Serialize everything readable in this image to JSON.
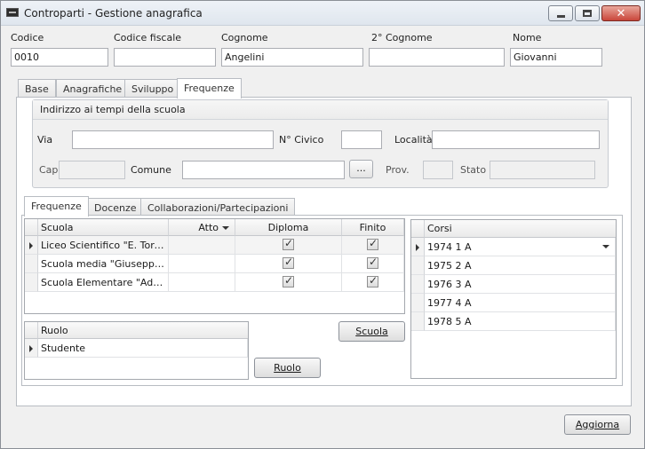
{
  "window": {
    "title": "Controparti - Gestione anagrafica"
  },
  "header_fields": {
    "codice": {
      "label": "Codice",
      "value": "0010"
    },
    "codice_fiscale": {
      "label": "Codice fiscale",
      "value": ""
    },
    "cognome": {
      "label": "Cognome",
      "value": "Angelini"
    },
    "secondo_cognome": {
      "label": "2° Cognome",
      "value": ""
    },
    "nome": {
      "label": "Nome",
      "value": "Giovanni"
    }
  },
  "main_tabs": [
    "Base",
    "Anagrafiche",
    "Sviluppo",
    "Frequenze"
  ],
  "address_group": {
    "title": "Indirizzo ai tempi della scuola",
    "via_label": "Via",
    "via": "",
    "civico_label": "N° Civico",
    "civico": "",
    "localita_label": "Località",
    "localita": "",
    "cap_label": "Cap",
    "cap": "",
    "comune_label": "Comune",
    "comune": "",
    "browse_label": "...",
    "prov_label": "Prov.",
    "prov": "",
    "stato_label": "Stato",
    "stato": ""
  },
  "sub_tabs": [
    "Frequenze",
    "Docenze",
    "Collaborazioni/Partecipazioni"
  ],
  "schools_grid": {
    "columns": [
      "Scuola",
      "Atto",
      "Diploma",
      "Finito"
    ],
    "rows": [
      {
        "scuola": "Liceo Scientifico \"E. Torricelli\"",
        "atto": "",
        "diploma": true,
        "finito": true
      },
      {
        "scuola": "Scuola media \"Giuseppe Ve...",
        "atto": "",
        "diploma": true,
        "finito": true
      },
      {
        "scuola": "Scuola Elementare \"Ada N...",
        "atto": "",
        "diploma": true,
        "finito": true
      }
    ]
  },
  "courses_grid": {
    "column": "Corsi",
    "rows": [
      "1974 1 A",
      "1975 2 A",
      "1976 3 A",
      "1977 4 A",
      "1978 5 A"
    ]
  },
  "roles_grid": {
    "column": "Ruolo",
    "rows": [
      "Studente"
    ]
  },
  "buttons": {
    "scuola": "Scuola",
    "ruolo": "Ruolo",
    "aggiorna": "Aggiorna"
  },
  "icons": {
    "app": "app-icon",
    "minimize": "minimize-icon",
    "maximize": "maximize-icon",
    "close": "close-icon"
  }
}
